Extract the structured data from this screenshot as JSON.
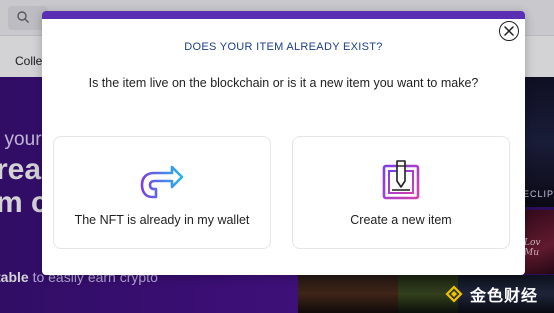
{
  "background": {
    "nav_item": "Colle",
    "hero_line1": "t your",
    "hero_line2": "rea",
    "hero_line3": "m c",
    "hero_line4_bold": "table",
    "hero_line4_rest": " to easily earn crypto",
    "art_1_text": "ECLIPS",
    "art_2_text": "Lov Mu"
  },
  "modal": {
    "title": "DOES YOUR ITEM ALREADY EXIST?",
    "subtitle": "Is the item live on the blockchain or is it a new item you want to make?",
    "options": [
      {
        "label": "The NFT is already in my wallet",
        "icon": "redirect-arrow-icon"
      },
      {
        "label": "Create a new item",
        "icon": "edit-item-icon"
      }
    ],
    "close_icon": "close-icon"
  },
  "watermark": {
    "text": "金色财经"
  },
  "colors": {
    "accent": "#5b2fb3",
    "title_blue": "#1c3d8f",
    "hero_purple": "#3a0f77",
    "icon_gradient_start": "#7b3fe4",
    "icon_gradient_end": "#25b6e8"
  }
}
